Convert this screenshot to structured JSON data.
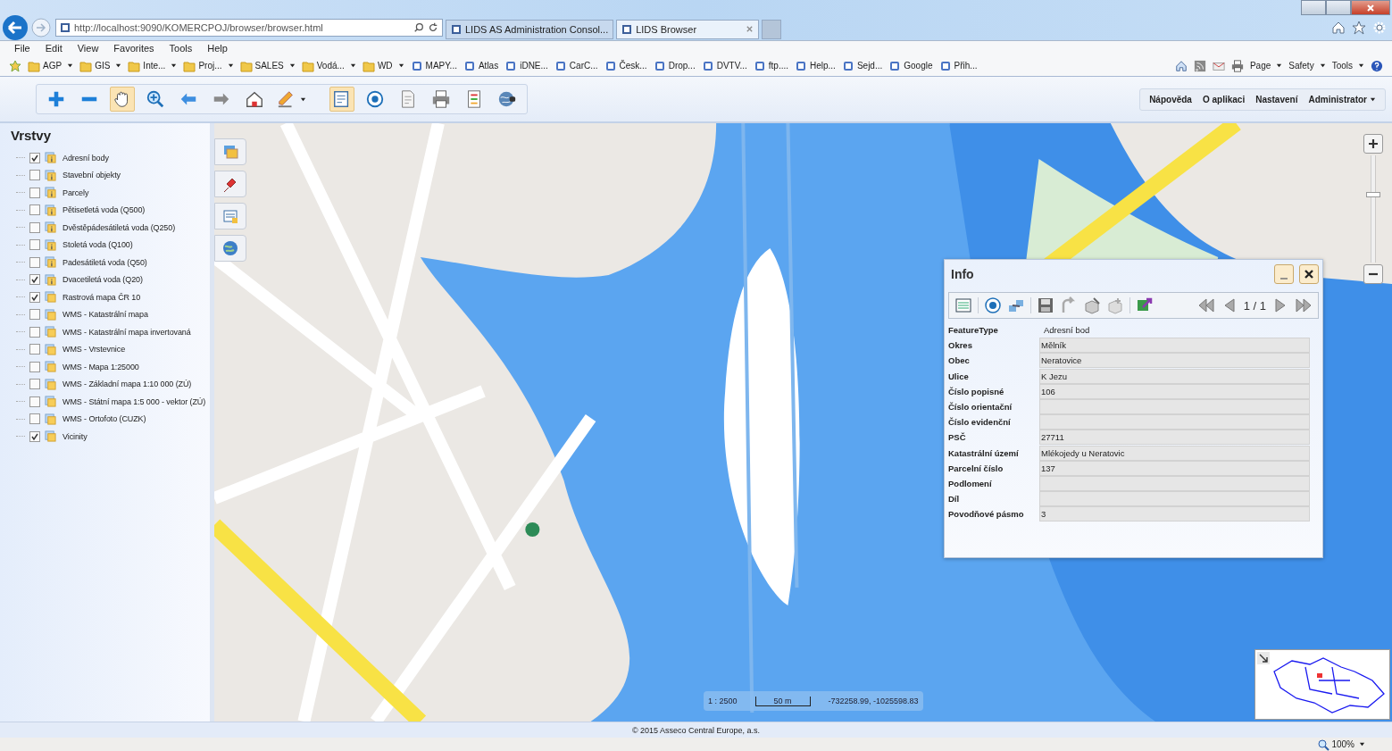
{
  "browser": {
    "address": "http://localhost:9090/KOMERCPOJ/browser/browser.html",
    "tabs": [
      {
        "title": "LIDS AS Administration Consol...",
        "selected": false
      },
      {
        "title": "LIDS Browser",
        "selected": true
      }
    ],
    "menu": [
      "File",
      "Edit",
      "View",
      "Favorites",
      "Tools",
      "Help"
    ],
    "favorites": [
      {
        "label": "AGP",
        "kind": "folder"
      },
      {
        "label": "GIS",
        "kind": "folder"
      },
      {
        "label": "Inte...",
        "kind": "folder"
      },
      {
        "label": "Proj...",
        "kind": "folder"
      },
      {
        "label": "SALES",
        "kind": "folder"
      },
      {
        "label": "Vodá...",
        "kind": "folder"
      },
      {
        "label": "WD",
        "kind": "folder"
      },
      {
        "label": "MAPY...",
        "kind": "link"
      },
      {
        "label": "Atlas",
        "kind": "link"
      },
      {
        "label": "iDNE...",
        "kind": "link"
      },
      {
        "label": "CarC...",
        "kind": "link"
      },
      {
        "label": "Česk...",
        "kind": "link"
      },
      {
        "label": "Drop...",
        "kind": "link"
      },
      {
        "label": "DVTV...",
        "kind": "link"
      },
      {
        "label": "ftp....",
        "kind": "link"
      },
      {
        "label": "Help...",
        "kind": "link"
      },
      {
        "label": "Sejd...",
        "kind": "link"
      },
      {
        "label": "Google",
        "kind": "link"
      },
      {
        "label": "Přih...",
        "kind": "link"
      }
    ],
    "command_bar": [
      "Page",
      "Safety",
      "Tools"
    ],
    "zoom": "100%"
  },
  "toolbar": {
    "tools": [
      {
        "kind": "zoom-in",
        "selected": false
      },
      {
        "kind": "zoom-out",
        "selected": false
      },
      {
        "kind": "pan",
        "selected": true
      },
      {
        "kind": "magnifier",
        "selected": false
      },
      {
        "kind": "back",
        "selected": false
      },
      {
        "kind": "forward",
        "selected": false
      },
      {
        "kind": "home",
        "selected": false
      },
      {
        "kind": "pencil",
        "selected": false
      },
      {
        "kind": "map-select",
        "selected": true
      },
      {
        "kind": "target",
        "selected": false
      },
      {
        "kind": "document",
        "selected": false
      },
      {
        "kind": "print",
        "selected": false
      },
      {
        "kind": "legend",
        "selected": false
      },
      {
        "kind": "globe",
        "selected": false
      }
    ],
    "links": [
      {
        "label": "Nápověda",
        "dropdown": false
      },
      {
        "label": "O aplikaci",
        "dropdown": false
      },
      {
        "label": "Nastavení",
        "dropdown": false
      },
      {
        "label": "Administrator",
        "dropdown": true
      }
    ]
  },
  "layers": {
    "title": "Vrstvy",
    "items": [
      {
        "label": "Adresní body",
        "checked": true,
        "kind": "info"
      },
      {
        "label": "Stavební objekty",
        "checked": false,
        "kind": "info"
      },
      {
        "label": "Parcely",
        "checked": false,
        "kind": "info"
      },
      {
        "label": "Pětisetletá voda (Q500)",
        "checked": false,
        "kind": "info"
      },
      {
        "label": "Dvěstěpádesátiletá voda (Q250)",
        "checked": false,
        "kind": "info"
      },
      {
        "label": "Stoletá voda (Q100)",
        "checked": false,
        "kind": "info"
      },
      {
        "label": "Padesátiletá voda (Q50)",
        "checked": false,
        "kind": "info"
      },
      {
        "label": "Dvacetiletá voda (Q20)",
        "checked": true,
        "kind": "info"
      },
      {
        "label": "Rastrová mapa ČR 10",
        "checked": true,
        "kind": "plain"
      },
      {
        "label": "WMS - Katastrální mapa",
        "checked": false,
        "kind": "plain"
      },
      {
        "label": "WMS - Katastrální mapa invertovaná",
        "checked": false,
        "kind": "plain"
      },
      {
        "label": "WMS - Vrstevnice",
        "checked": false,
        "kind": "plain"
      },
      {
        "label": "WMS - Mapa 1:25000",
        "checked": false,
        "kind": "plain"
      },
      {
        "label": "WMS - Základní mapa 1:10 000 (ZÚ)",
        "checked": false,
        "kind": "plain"
      },
      {
        "label": "WMS - Státní mapa 1:5 000 - vektor (ZÚ)",
        "checked": false,
        "kind": "plain"
      },
      {
        "label": "WMS - Ortofoto (CUZK)",
        "checked": false,
        "kind": "plain"
      },
      {
        "label": "Vicinity",
        "checked": true,
        "kind": "plain"
      }
    ]
  },
  "map": {
    "zoom_slider": {
      "level": 0.63
    },
    "scale": "1 : 2500",
    "scale_bar": "50 m",
    "coordinates": "-732258.99, -1025598.83",
    "info": {
      "title": "Info",
      "pager": "1 / 1",
      "feature_type": {
        "label": "FeatureType",
        "value": "Adresní bod"
      },
      "fields": [
        {
          "label": "Okres",
          "value": "Mělník"
        },
        {
          "label": "Obec",
          "value": "Neratovice"
        },
        {
          "label": "Ulice",
          "value": "K Jezu"
        },
        {
          "label": "Číslo popisné",
          "value": "106"
        },
        {
          "label": "Číslo orientační"
        },
        {
          "label": "Číslo evidenční"
        },
        {
          "label": "PSČ",
          "value": "27711"
        },
        {
          "label": "Katastrální území",
          "value": "Mlékojedy u Neratovic"
        },
        {
          "label": "Parcelní číslo",
          "value": "137"
        },
        {
          "label": "Podlomení"
        },
        {
          "label": "Díl"
        },
        {
          "label": "Povodňové pásmo",
          "value": "3"
        }
      ]
    }
  },
  "footer": "© 2015 Asseco Central Europe, a.s."
}
